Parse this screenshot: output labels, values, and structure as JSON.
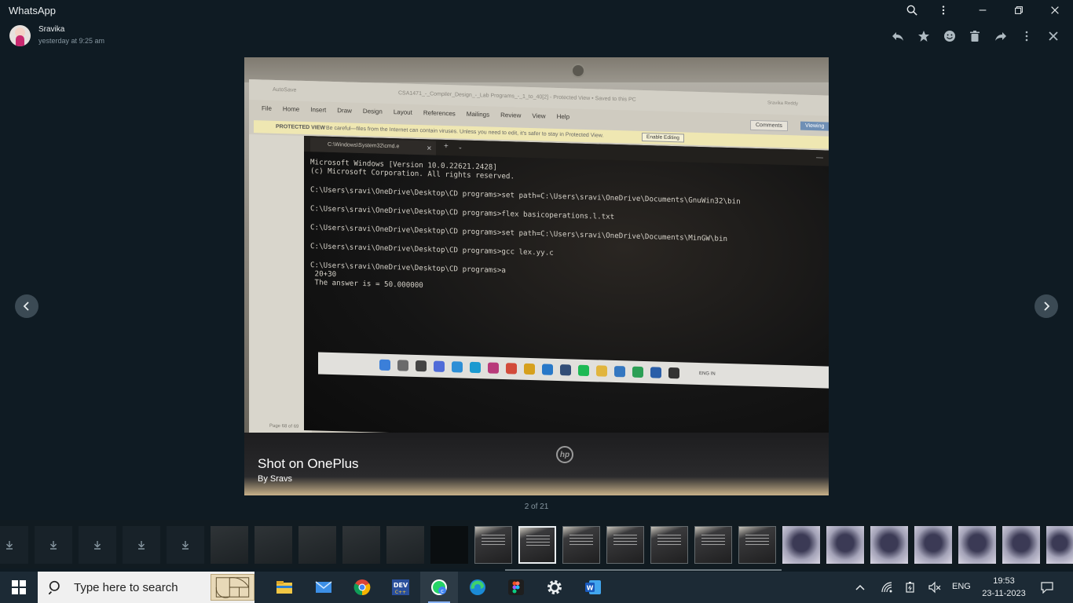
{
  "app": {
    "title": "WhatsApp"
  },
  "viewer": {
    "sender_name": "Sravika",
    "sender_time": "yesterday at 9:25 am",
    "counter": "2 of 21"
  },
  "photo": {
    "word": {
      "autosave": "AutoSave",
      "title": "CSA1471_-_Compiler_Design_-_Lab Programs_-_1_to_40[2]  -  Protected View  •  Saved to this PC",
      "user": "Sravika Reddy",
      "menu": [
        "File",
        "Home",
        "Insert",
        "Draw",
        "Design",
        "Layout",
        "References",
        "Mailings",
        "Review",
        "View",
        "Help"
      ],
      "protected_label": "PROTECTED VIEW",
      "protected_text": "Be careful—files from the Internet can contain viruses. Unless you need to edit, it's safer to stay in Protected View.",
      "enable_editing": "Enable Editing",
      "comments": "Comments",
      "viewing": "Viewing",
      "page_count": "Page 68 of 69"
    },
    "cmd_tab_title": "C:\\Windows\\System32\\cmd.e",
    "terminal_lines": [
      "Microsoft Windows [Version 10.0.22621.2428]",
      "(c) Microsoft Corporation. All rights reserved.",
      "",
      "C:\\Users\\sravi\\OneDrive\\Desktop\\CD programs>set path=C:\\Users\\sravi\\OneDrive\\Documents\\GnuWin32\\bin",
      "",
      "C:\\Users\\sravi\\OneDrive\\Desktop\\CD programs>flex basicoperations.l.txt",
      "",
      "C:\\Users\\sravi\\OneDrive\\Desktop\\CD programs>set path=C:\\Users\\sravi\\OneDrive\\Documents\\MinGW\\bin",
      "",
      "C:\\Users\\sravi\\OneDrive\\Desktop\\CD programs>gcc lex.yy.c",
      "",
      "C:\\Users\\sravi\\OneDrive\\Desktop\\CD programs>a",
      " 20+30",
      " The answer is = 50.000000"
    ],
    "laptop_tray_lang": "ENG IN",
    "shot_title": "Shot on OnePlus",
    "shot_by": "By Sravs",
    "brand": "hp"
  },
  "taskbar": {
    "search_placeholder": "Type here to search",
    "lang": "ENG",
    "time": "19:53",
    "date": "23-11-2023"
  },
  "colors": {
    "accent": "#8ab4f8",
    "background": "#0f1b23",
    "taskbar": "#1c2a35"
  }
}
